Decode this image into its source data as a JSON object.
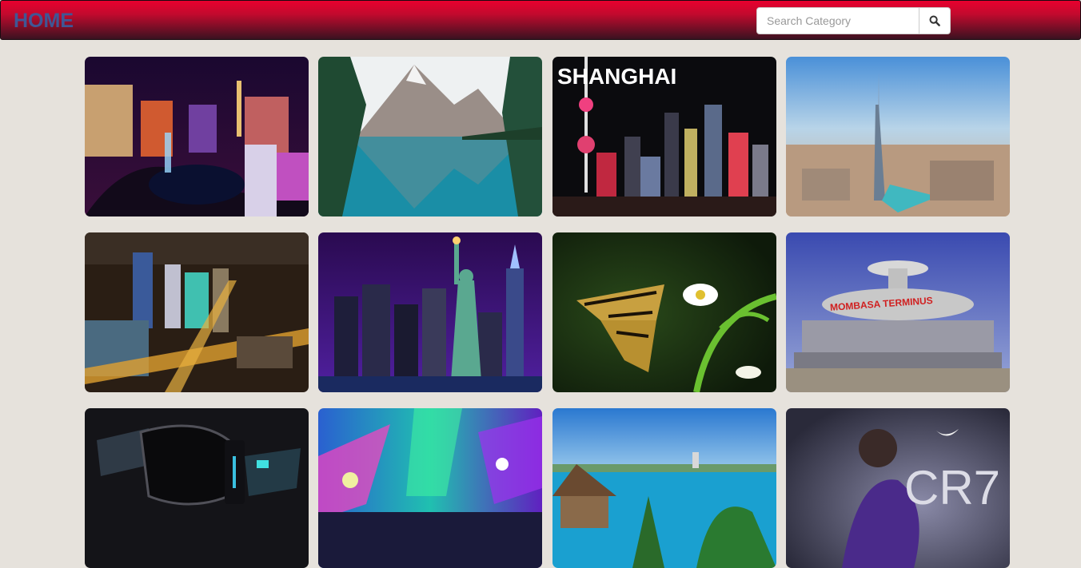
{
  "navbar": {
    "brand": "HOME",
    "search_placeholder": "Search Category",
    "search_icon": "search-icon",
    "colors": {
      "bar_top": "#e8002e",
      "bar_bottom": "#3a1220",
      "brand": "#3f5796"
    }
  },
  "gallery": {
    "tiles": [
      {
        "subject": "las-vegas-night"
      },
      {
        "subject": "mountain-lake"
      },
      {
        "subject": "shanghai-skyline",
        "caption": "SHANGHAI"
      },
      {
        "subject": "dubai-burj-khalifa"
      },
      {
        "subject": "city-night-aerial"
      },
      {
        "subject": "statue-of-liberty-night"
      },
      {
        "subject": "butterfly-flower"
      },
      {
        "subject": "mombasa-terminus",
        "caption": "MOMBASA TERMINUS"
      },
      {
        "subject": "smartwatch"
      },
      {
        "subject": "concert-lights"
      },
      {
        "subject": "tropical-coast"
      },
      {
        "subject": "cr7-poster",
        "caption": "CR7"
      }
    ]
  }
}
